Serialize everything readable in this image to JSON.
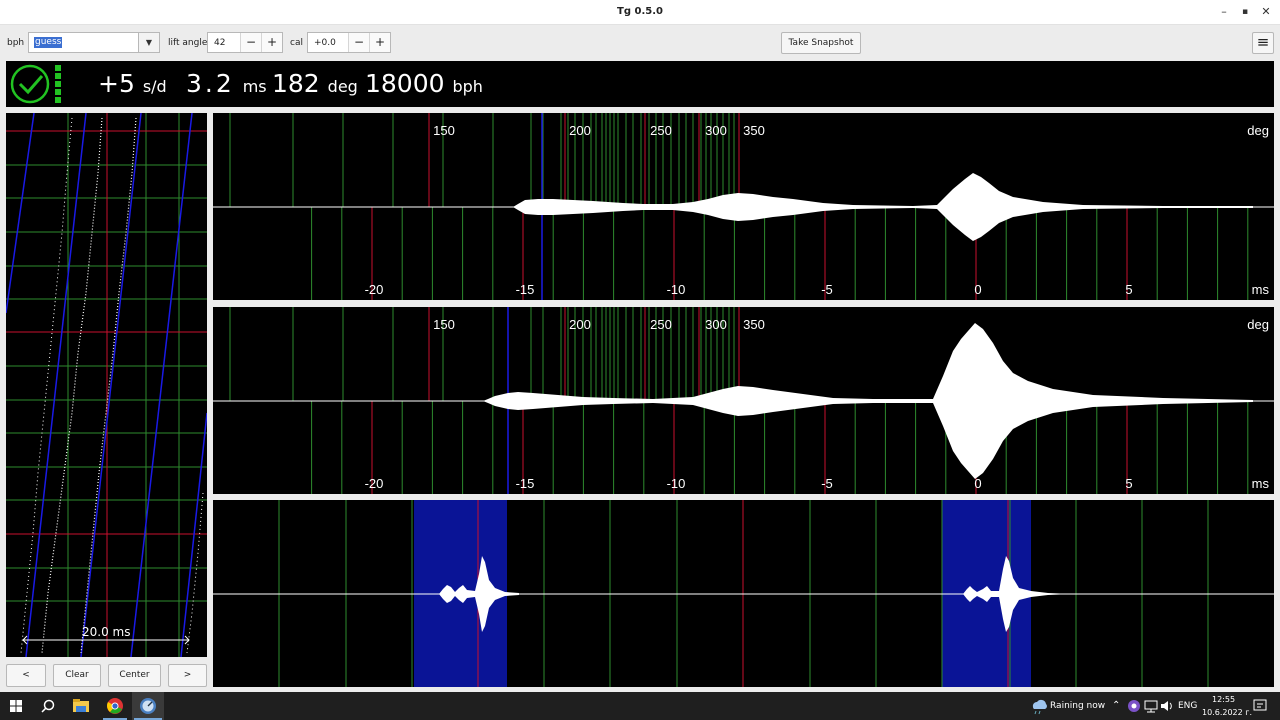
{
  "window": {
    "title": "Tg 0.5.0",
    "minimize_glyph": "–",
    "maximize_glyph": "▪",
    "close_glyph": "✕"
  },
  "toolbar": {
    "bph_label": "bph",
    "bph_value": "guess",
    "lift_angle_label": "lift angle",
    "lift_angle_value": "42",
    "cal_label": "cal",
    "cal_value": "+0.0",
    "minus": "−",
    "plus": "+",
    "snapshot_label": "Take Snapshot",
    "menu_glyph": "≡"
  },
  "status": {
    "rate_value": "+5",
    "rate_unit": "s/d",
    "beat_error_value": "3.2",
    "beat_error_unit": "ms",
    "amplitude_value": "182",
    "amplitude_unit": "deg",
    "bph_value": "18000",
    "bph_unit": "bph",
    "signal_bars": 5
  },
  "paperstrip": {
    "scale_label": "20.0 ms"
  },
  "scopes": {
    "deg_labels": [
      "150",
      "200",
      "250",
      "300",
      "350"
    ],
    "deg_unit": "deg",
    "ms_labels": [
      "-20",
      "-15",
      "-10",
      "-5",
      "0",
      "5"
    ],
    "ms_unit": "ms"
  },
  "buttons": {
    "prev": "<",
    "clear": "Clear",
    "center": "Center",
    "next": ">"
  },
  "taskbar": {
    "weather": "Raining now",
    "lang": "ENG",
    "time": "12:55",
    "date": "10.6.2022 г."
  },
  "colors": {
    "grid_green": "#2e8b2e",
    "marker_red": "#c8102e",
    "trace_blue": "#1a1ae6",
    "highlight_blue": "#0a1496",
    "ok_green": "#22c322"
  }
}
